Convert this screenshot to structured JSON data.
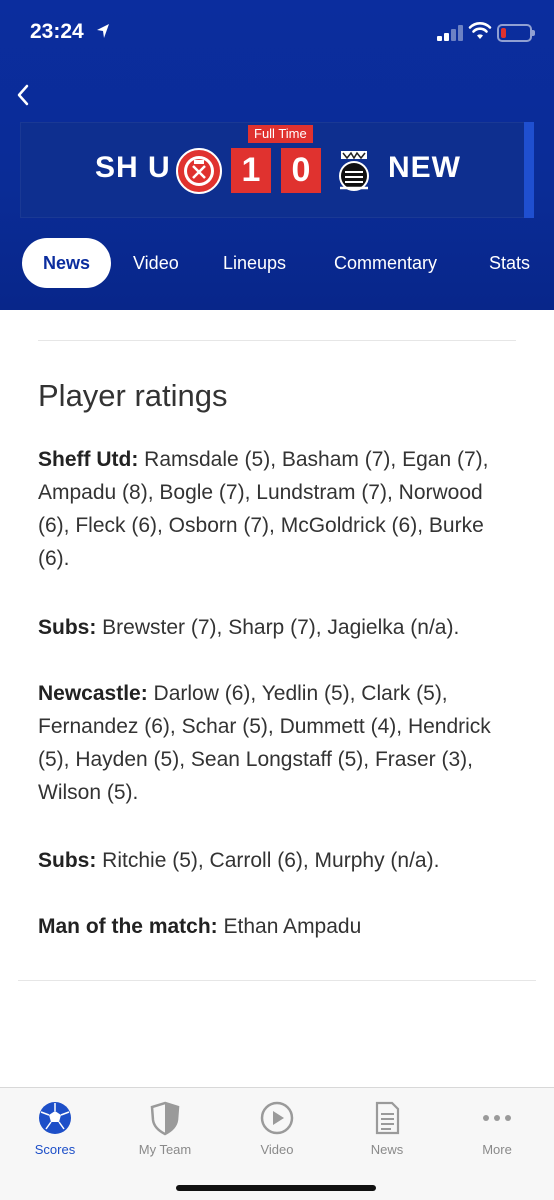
{
  "status": {
    "time": "23:24"
  },
  "match": {
    "status_label": "Full Time",
    "home_team": "SH U",
    "away_team": "NEW",
    "home_score": "1",
    "away_score": "0"
  },
  "tabs": [
    {
      "label": "News",
      "active": true
    },
    {
      "label": "Video"
    },
    {
      "label": "Lineups"
    },
    {
      "label": "Commentary"
    },
    {
      "label": "Stats"
    }
  ],
  "article": {
    "title": "Player ratings",
    "sections": [
      {
        "label": "Sheff Utd:",
        "text": " Ramsdale (5), Basham (7), Egan (7), Ampadu (8), Bogle (7), Lundstram (7), Norwood (6), Fleck (6), Osborn (7), McGoldrick (6), Burke (6)."
      },
      {
        "label": "Subs:",
        "text": " Brewster (7), Sharp (7), Jagielka (n/a)."
      },
      {
        "label": "Newcastle:",
        "text": " Darlow (6), Yedlin (5), Clark (5), Fernandez (6), Schar (5), Dummett (4), Hendrick (5), Hayden (5), Sean Longstaff (5), Fraser (3), Wilson (5)."
      },
      {
        "label": "Subs:",
        "text": " Ritchie (5), Carroll (6), Murphy (n/a)."
      },
      {
        "label": "Man of the match:",
        "text": " Ethan Ampadu"
      }
    ]
  },
  "bottom_nav": [
    {
      "label": "Scores",
      "icon": "football-icon",
      "active": true
    },
    {
      "label": "My Team",
      "icon": "shield-icon"
    },
    {
      "label": "Video",
      "icon": "play-icon"
    },
    {
      "label": "News",
      "icon": "document-icon"
    },
    {
      "label": "More",
      "icon": "more-dots-icon"
    }
  ],
  "colors": {
    "brand_blue": "#0b2d9e",
    "accent_red": "#e0322f",
    "active_nav": "#1d4fc8"
  }
}
